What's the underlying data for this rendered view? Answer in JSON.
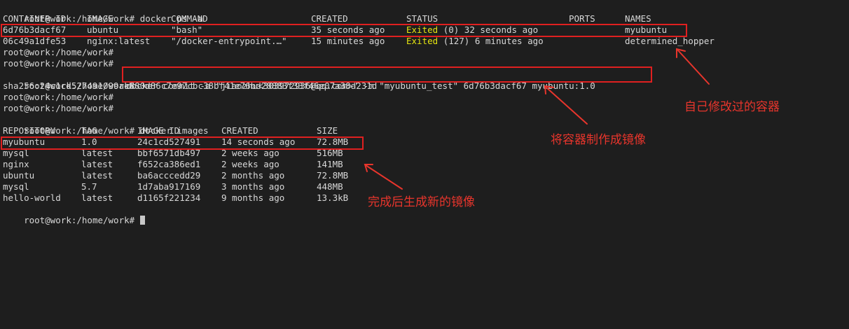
{
  "prompt": "root@work:/home/work#",
  "cmd_ps": "docker ps -a",
  "ps_headers": [
    "CONTAINER ID",
    "IMAGE",
    "COMMAND",
    "CREATED",
    "STATUS",
    "PORTS",
    "NAMES"
  ],
  "ps_rows": [
    {
      "id": "6d76b3dacf67",
      "image": "ubuntu",
      "command": "\"bash\"",
      "created": "35 seconds ago",
      "status_word": "Exited",
      "status_rest": "(0) 32 seconds ago",
      "ports": "",
      "name": "myubuntu"
    },
    {
      "id": "06c49a1dfe53",
      "image": "nginx:latest",
      "command": "\"/docker-entrypoint.…\"",
      "created": "15 minutes ago",
      "status_word": "Exited",
      "status_rest": "(127) 6 minutes ago",
      "ports": "",
      "name": "determined_hopper"
    }
  ],
  "cmd_commit": "docker commit -a \"jiaozhu<303972936@qq.com>\" -m \"myubuntu_test\" 6d76b3dacf67 myubuntu:1.0",
  "sha_output": "sha256:24c1cd527491099ae880d86c7e97cbc38bf41e76bd28883f33f46e07a38a231d",
  "cmd_images": "docker images",
  "img_headers": [
    "REPOSITORY",
    "TAG",
    "IMAGE ID",
    "CREATED",
    "SIZE"
  ],
  "img_rows": [
    {
      "repo": "myubuntu",
      "tag": "1.0",
      "id": "24c1cd527491",
      "created": "14 seconds ago",
      "size": "72.8MB"
    },
    {
      "repo": "mysql",
      "tag": "latest",
      "id": "bbf6571db497",
      "created": "2 weeks ago",
      "size": "516MB"
    },
    {
      "repo": "nginx",
      "tag": "latest",
      "id": "f652ca386ed1",
      "created": "2 weeks ago",
      "size": "141MB"
    },
    {
      "repo": "ubuntu",
      "tag": "latest",
      "id": "ba6acccedd29",
      "created": "2 months ago",
      "size": "72.8MB"
    },
    {
      "repo": "mysql",
      "tag": "5.7",
      "id": "1d7aba917169",
      "created": "3 months ago",
      "size": "448MB"
    },
    {
      "repo": "hello-world",
      "tag": "latest",
      "id": "d1165f221234",
      "created": "9 months ago",
      "size": "13.3kB"
    }
  ],
  "annotations": {
    "modified_container": "自己修改过的容器",
    "commit_to_image": "将容器制作成镜像",
    "new_image": "完成后生成新的镜像"
  },
  "colors": {
    "background": "#1e1e1e",
    "text": "#d8d8d8",
    "exited": "#e5e510",
    "annotation": "#e8352c"
  }
}
